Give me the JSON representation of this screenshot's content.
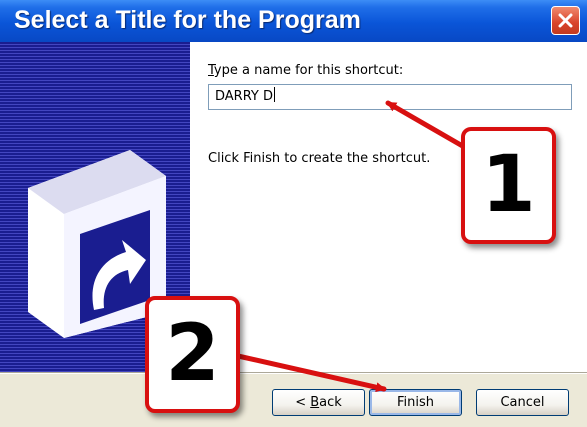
{
  "window": {
    "title": "Select a Title for the Program",
    "close_icon": "close-icon",
    "titlebar_color": "#0a55d8",
    "close_color": "#d9432a"
  },
  "banner": {
    "icon": "shortcut-arrow-icon",
    "color": "#1a1d90"
  },
  "form": {
    "label_accel": "T",
    "label_rest": "ype a name for this shortcut:",
    "name_value": "DARRY D",
    "info_text": "Click Finish to create the shortcut."
  },
  "buttons": {
    "back_prefix": "< ",
    "back_accel": "B",
    "back_rest": "ack",
    "finish": "Finish",
    "cancel": "Cancel"
  },
  "annotations": {
    "step1": "1",
    "step2": "2",
    "color": "#d81010"
  }
}
